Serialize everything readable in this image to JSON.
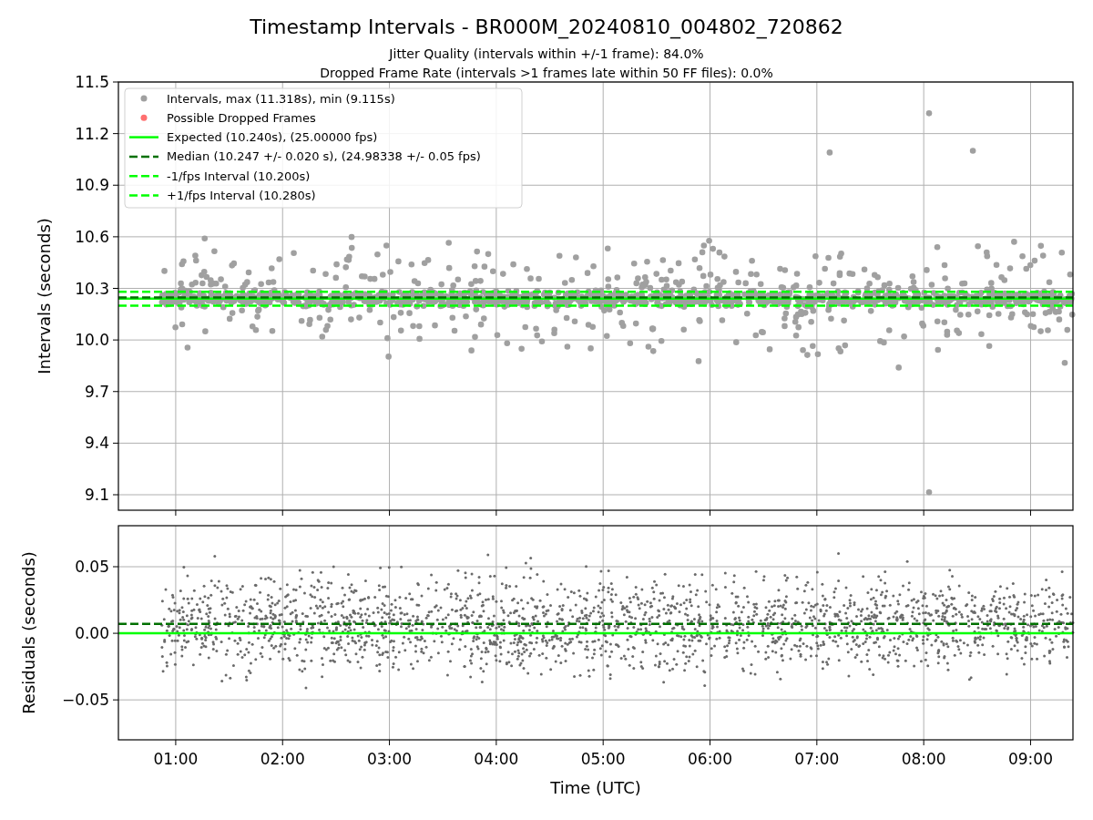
{
  "figure": {
    "title": "Timestamp Intervals - BR000M_20240810_004802_720862",
    "subtitles": [
      "Jitter Quality (intervals within +/-1 frame): 84.0%",
      "Dropped Frame Rate (intervals >1 frames late within 50 FF files): 0.0%"
    ]
  },
  "intervals_plot": {
    "markers": [
      {
        "label": "Intervals, max (11.318s), min (9.115s)",
        "color": "#a0a0a0"
      },
      {
        "label": "Possible Dropped Frames",
        "color": "#ff7070"
      }
    ],
    "chart_data": {
      "type": "line",
      "ylabel": "Intervals (seconds)",
      "x": [
        0.4637,
        9.3967
      ],
      "xlim": [
        0.4637,
        9.3967
      ],
      "ylim": [
        9.01,
        11.5
      ],
      "grid": true,
      "legend": true,
      "yticks": [
        {
          "value": 9.1,
          "label": "9.1"
        },
        {
          "value": 9.4,
          "label": "9.4"
        },
        {
          "value": 9.7,
          "label": "9.7"
        },
        {
          "value": 10.0,
          "label": "10.0"
        },
        {
          "value": 10.3,
          "label": "10.3"
        },
        {
          "value": 10.6,
          "label": "10.6"
        },
        {
          "value": 10.9,
          "label": "10.9"
        },
        {
          "value": 11.2,
          "label": "11.2"
        },
        {
          "value": 11.5,
          "label": "11.5"
        }
      ],
      "series": [
        {
          "name": "Expected (10.240s), (25.00000 fps)",
          "color": "#00ff00",
          "line_style": "solid",
          "values": [
            10.24,
            10.24
          ]
        },
        {
          "name": "Median (10.247 +/- 0.020 s), (24.98338 +/- 0.05 fps)",
          "color": "#007000",
          "line_style": "dashed",
          "values": [
            10.247,
            10.247
          ]
        },
        {
          "name": "-1/fps Interval (10.200s)",
          "color": "#00ff00",
          "line_style": "dashed",
          "values": [
            10.2,
            10.2
          ]
        },
        {
          "name": "+1/fps Interval (10.280s)",
          "color": "#00ff00",
          "line_style": "dashed",
          "values": [
            10.28,
            10.28
          ]
        }
      ]
    }
  },
  "residuals_plot": {
    "chart_data": {
      "type": "line",
      "xlabel": "Time (UTC)",
      "ylabel": "Residuals (seconds)",
      "x": [
        0.4637,
        9.3967
      ],
      "xlim": [
        0.4637,
        9.3967
      ],
      "ylim": [
        -0.08,
        0.0808
      ],
      "grid": true,
      "xticks": [
        {
          "value": 1,
          "label": "01:00"
        },
        {
          "value": 2,
          "label": "02:00"
        },
        {
          "value": 3,
          "label": "03:00"
        },
        {
          "value": 4,
          "label": "04:00"
        },
        {
          "value": 5,
          "label": "05:00"
        },
        {
          "value": 6,
          "label": "06:00"
        },
        {
          "value": 7,
          "label": "07:00"
        },
        {
          "value": 8,
          "label": "08:00"
        },
        {
          "value": 9,
          "label": "09:00"
        }
      ],
      "yticks": [
        {
          "value": -0.05,
          "label": "−0.05"
        },
        {
          "value": 0,
          "label": "0.00"
        },
        {
          "value": 0.05,
          "label": "0.05"
        }
      ],
      "series": [
        {
          "color": "#00ff00",
          "line_style": "solid",
          "values": [
            0,
            0
          ]
        },
        {
          "color": "#007000",
          "line_style": "dashed",
          "values": [
            0.007,
            0.007
          ]
        }
      ]
    }
  }
}
